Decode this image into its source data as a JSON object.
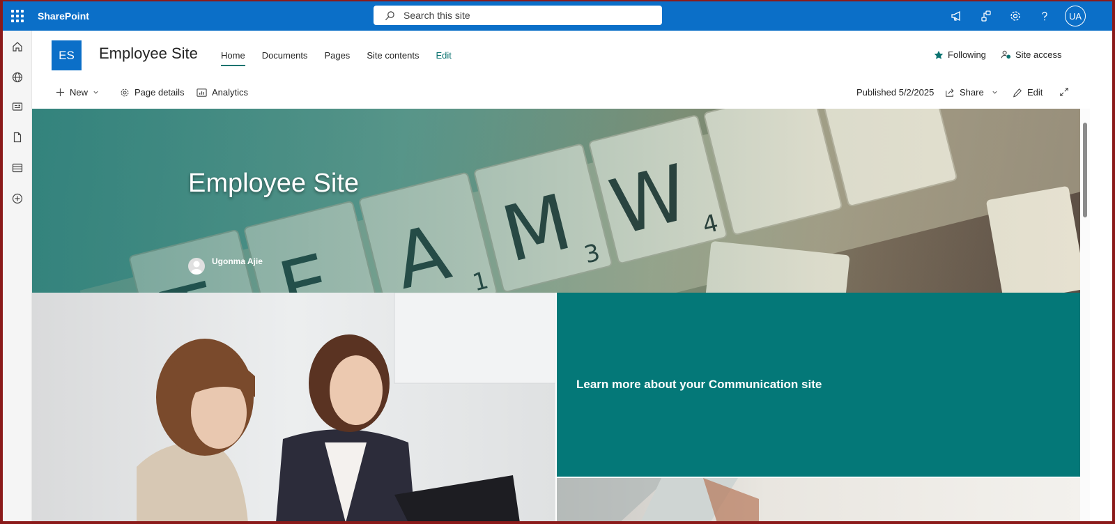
{
  "suite": {
    "brand": "SharePoint",
    "search_placeholder": "Search this site",
    "avatar_initials": "UA",
    "accent_color": "#0b6fc8"
  },
  "site": {
    "logo_initials": "ES",
    "title": "Employee Site",
    "nav": [
      {
        "label": "Home",
        "active": true
      },
      {
        "label": "Documents"
      },
      {
        "label": "Pages"
      },
      {
        "label": "Site contents"
      },
      {
        "label": "Edit"
      }
    ],
    "following_label": "Following",
    "site_access_label": "Site access"
  },
  "command_bar": {
    "new_label": "New",
    "page_details_label": "Page details",
    "analytics_label": "Analytics",
    "published_label": "Published 5/2/2025",
    "share_label": "Share",
    "edit_label": "Edit"
  },
  "hero": {
    "title": "Employee Site",
    "author": "Ugonma Ajie"
  },
  "tiles": {
    "learn_more": "Learn more about your Communication site",
    "teal_color": "#047878"
  }
}
